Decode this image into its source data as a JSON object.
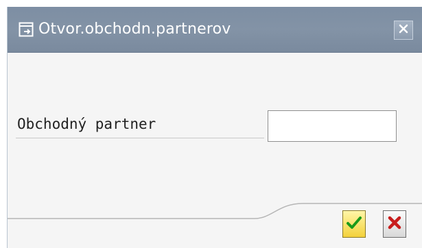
{
  "window": {
    "title": "Otvor.obchodn.partnerov",
    "title_icon": "open-document-icon",
    "close_icon": "close-icon"
  },
  "form": {
    "business_partner_label": "Obchodný partner",
    "business_partner_value": ""
  },
  "actions": {
    "confirm_icon": "checkmark-icon",
    "cancel_icon": "cancel-x-icon"
  },
  "colors": {
    "titlebar": "#7d8ea3",
    "content_bg": "#f5f5f5",
    "confirm_check": "#1a9a1a",
    "cancel_x": "#c81d1d"
  }
}
